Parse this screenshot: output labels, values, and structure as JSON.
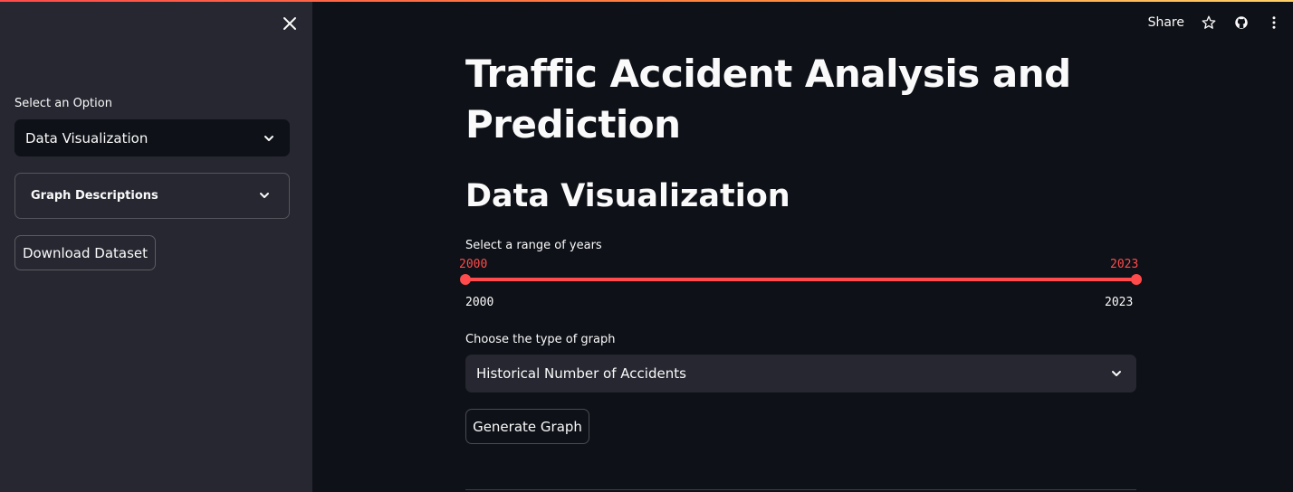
{
  "sidebar": {
    "select_label": "Select an Option",
    "select_value": "Data Visualization",
    "expander_label": "Graph Descriptions",
    "download_button": "Download Dataset"
  },
  "header": {
    "share_label": "Share"
  },
  "main": {
    "title": "Traffic Accident Analysis and Prediction",
    "section_title": "Data Visualization",
    "year_range": {
      "label": "Select a range of years",
      "selected_min": "2000",
      "selected_max": "2023",
      "min": "2000",
      "max": "2023"
    },
    "graph_type": {
      "label": "Choose the type of graph",
      "value": "Historical Number of Accidents"
    },
    "generate_button": "Generate Graph"
  },
  "colors": {
    "accent": "#ff4b4b",
    "background": "#0e1117",
    "sidebar": "#262730"
  }
}
